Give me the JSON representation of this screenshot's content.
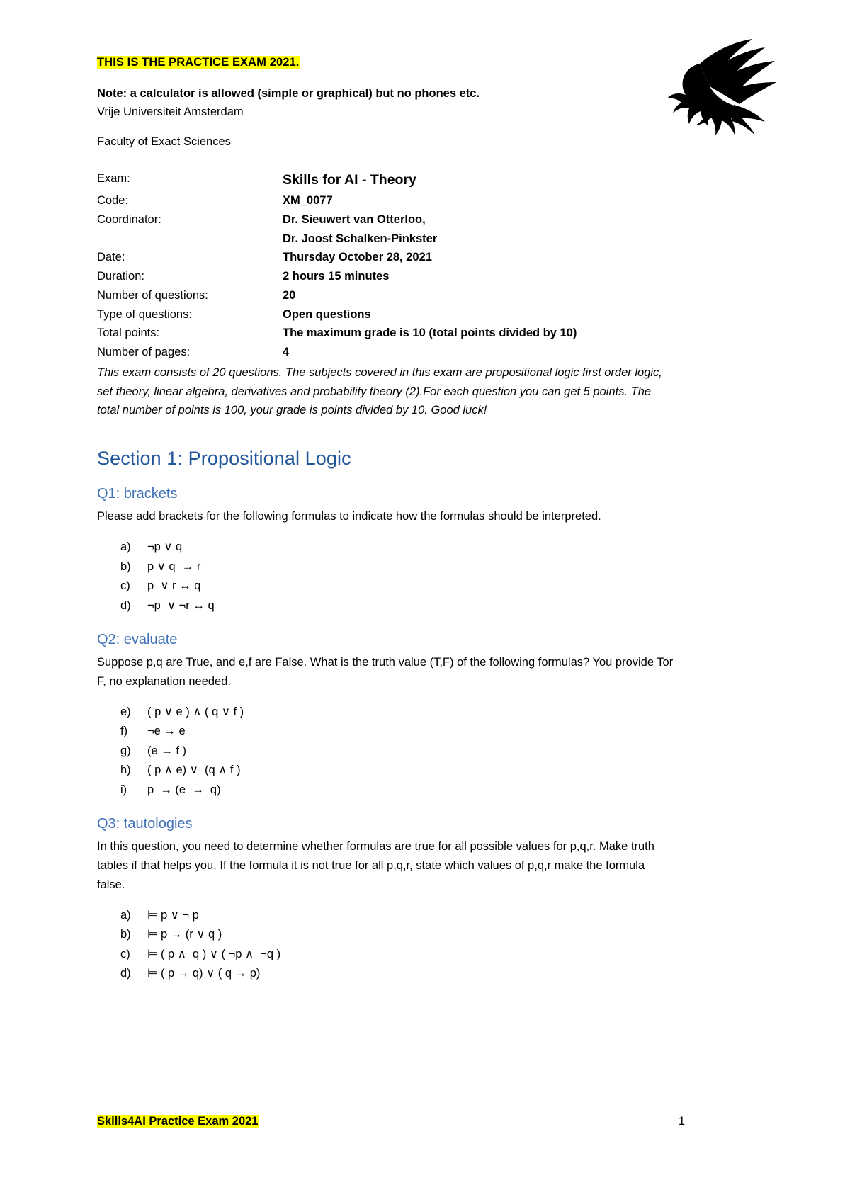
{
  "header": {
    "practice_notice": "THIS IS THE PRACTICE EXAM 2021.",
    "note": "Note: a calculator is allowed (simple or graphical) but no phones etc.",
    "university": "Vrije Universiteit Amsterdam",
    "faculty": "Faculty of Exact Sciences",
    "logo_name": "vu-griffin-logo"
  },
  "details": [
    {
      "key": "Exam:",
      "value": "Skills for AI  - Theory",
      "big": true
    },
    {
      "key": "Code:",
      "value": "XM_0077",
      "big": false
    },
    {
      "key": "Coordinator:",
      "value": "Dr. Sieuwert van Otterloo,",
      "big": false
    },
    {
      "key": "",
      "value": "Dr. Joost Schalken-Pinkster",
      "big": false
    },
    {
      "key": "Date:",
      "value": "Thursday October 28, 2021",
      "big": false
    },
    {
      "key": "Duration:",
      "value": "2 hours 15 minutes",
      "big": false
    },
    {
      "key": "Number of questions:",
      "value": "20",
      "big": false
    },
    {
      "key": "Type of questions:",
      "value": "Open questions",
      "big": false
    },
    {
      "key": "Total points:",
      "value": "The maximum grade is 10 (total points divided by 10)",
      "big": false
    },
    {
      "key": "Number of pages:",
      "value": "4",
      "big": false
    }
  ],
  "intro": "This exam consists of 20 questions. The subjects covered in this exam are propositional logic  first order logic, set theory, linear algebra, derivatives and probability theory (2).For each question you can get 5 points. The total number of points is 100, your grade is points divided by 10. Good luck!",
  "section": {
    "title": "Section 1: Propositional Logic"
  },
  "questions": [
    {
      "heading": "Q1: brackets",
      "body": "Please add brackets for the following formulas to indicate how the formulas should be interpreted.",
      "items": [
        {
          "label": "a)",
          "formula": "¬p ∨ q"
        },
        {
          "label": "b)",
          "formula": "p ∨ q  → r"
        },
        {
          "label": "c)",
          "formula": "p  ∨ r ↔ q"
        },
        {
          "label": "d)",
          "formula": "¬p  ∨ ¬r ↔ q"
        }
      ]
    },
    {
      "heading": "Q2: evaluate",
      "body": "Suppose p,q are True, and e,f are False. What is the truth value (T,F) of the following formulas? You provide Tor F, no explanation needed.",
      "items": [
        {
          "label": "e)",
          "formula": "( p ∨ e ) ∧ ( q ∨ f )"
        },
        {
          "label": "f)",
          "formula": "¬e → e"
        },
        {
          "label": "g)",
          "formula": "(e → f )"
        },
        {
          "label": "h)",
          "formula": "( p ∧ e) ∨  (q ∧ f )"
        },
        {
          "label": "i)",
          "formula": "p  → (e  →  q)"
        }
      ]
    },
    {
      "heading": "Q3: tautologies",
      "body": "In this question, you need to determine whether formulas are true for all possible values for p,q,r. Make truth tables if that helps you. If the formula it is not true for all p,q,r, state which values of p,q,r make the formula false.",
      "items": [
        {
          "label": "a)",
          "formula": "⊨ p ∨ ¬ p"
        },
        {
          "label": "b)",
          "formula": "⊨ p → (r ∨ q )"
        },
        {
          "label": "c)",
          "formula": "⊨ ( p ∧  q ) ∨ ( ¬p ∧  ¬q )"
        },
        {
          "label": "d)",
          "formula": "⊨ ( p → q) ∨ ( q → p)"
        }
      ]
    }
  ],
  "footer": {
    "left": "Skills4AI Practice Exam 2021",
    "page": "1"
  },
  "colors": {
    "highlight": "#ffff00",
    "section_heading": "#1f5599",
    "question_heading": "#3f72b8"
  }
}
